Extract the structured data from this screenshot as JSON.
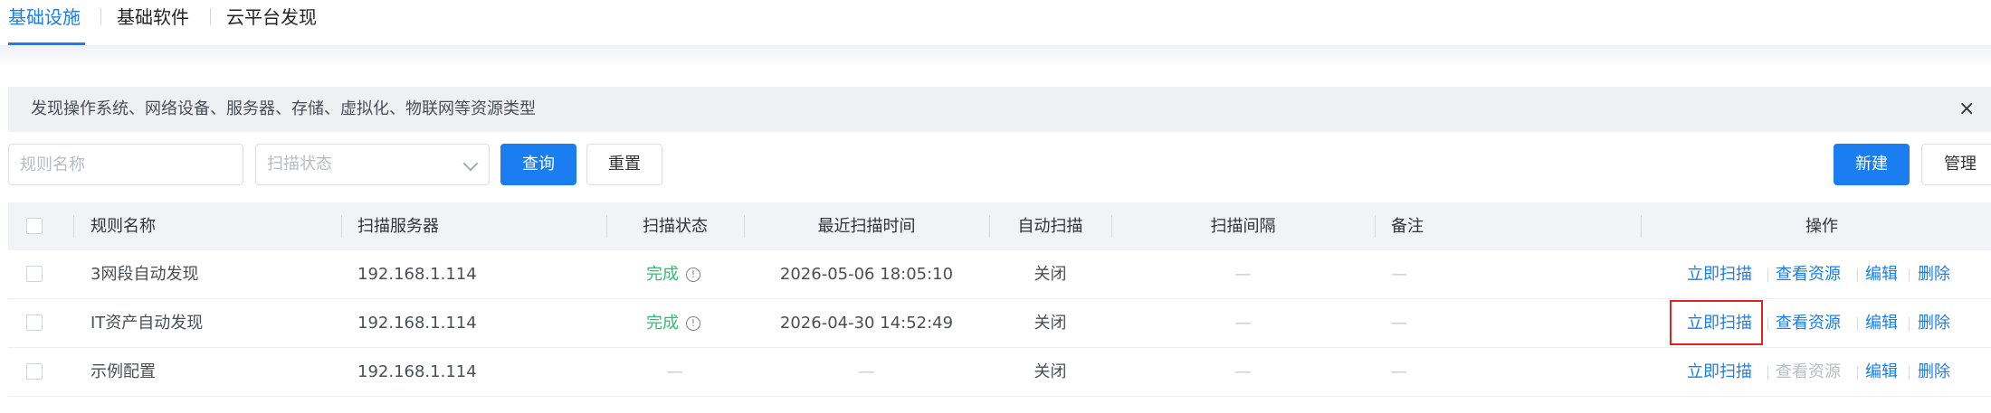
{
  "tabs": [
    {
      "label": "基础设施",
      "active": true
    },
    {
      "label": "基础软件",
      "active": false
    },
    {
      "label": "云平台发现",
      "active": false
    }
  ],
  "banner": {
    "text": "发现操作系统、网络设备、服务器、存储、虚拟化、物联网等资源类型",
    "close_icon": "×"
  },
  "filters": {
    "rule_name_placeholder": "规则名称",
    "scan_status_placeholder": "扫描状态",
    "query_label": "查询",
    "reset_label": "重置"
  },
  "toolbar": {
    "new_label": "新建",
    "manage_label": "管理"
  },
  "table": {
    "headers": {
      "rule_name": "规则名称",
      "scan_server": "扫描服务器",
      "scan_status": "扫描状态",
      "last_scan_time": "最近扫描时间",
      "auto_scan": "自动扫描",
      "scan_interval": "扫描间隔",
      "remark": "备注",
      "actions": "操作"
    },
    "rows": [
      {
        "rule_name": "3网段自动发现",
        "scan_server": "192.168.1.114",
        "scan_status": "完成",
        "last_scan_time": "2026-05-06 18:05:10",
        "auto_scan": "关闭",
        "scan_interval": "—",
        "remark": "—",
        "view_enabled": true
      },
      {
        "rule_name": "IT资产自动发现",
        "scan_server": "192.168.1.114",
        "scan_status": "完成",
        "last_scan_time": "2026-04-30 14:52:49",
        "auto_scan": "关闭",
        "scan_interval": "—",
        "remark": "—",
        "view_enabled": true
      },
      {
        "rule_name": "示例配置",
        "scan_server": "192.168.1.114",
        "scan_status": "—",
        "last_scan_time": "—",
        "auto_scan": "关闭",
        "scan_interval": "—",
        "remark": "—",
        "view_enabled": false
      }
    ],
    "actions": {
      "scan_now": "立即扫描",
      "view_resources": "查看资源",
      "edit": "编辑",
      "delete": "删除"
    }
  },
  "colors": {
    "accent": "#1a7ef0",
    "success": "#2fbf71",
    "highlight": "#e02424"
  }
}
